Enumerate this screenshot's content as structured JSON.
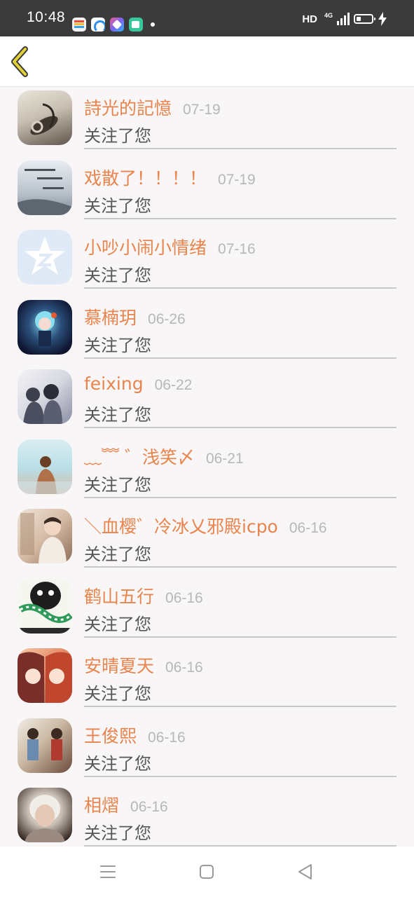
{
  "status_bar": {
    "time": "10:48",
    "hd": "HD",
    "network": "4G",
    "notification_icons": [
      "wallet-app-icon",
      "browser-app-icon",
      "gallery-app-icon",
      "messages-app-icon"
    ]
  },
  "header": {
    "back_icon": "chevron-left-icon",
    "accent_color": "#e2d13a"
  },
  "colors": {
    "name": "#e8844c",
    "date": "#b7b7b7",
    "action": "#565656",
    "background": "#f9f6f8"
  },
  "followers": [
    {
      "name": "詩光的記憶",
      "date": "07-19",
      "action": "关注了您"
    },
    {
      "name": "戏散了！！！！",
      "date": "07-19",
      "action": "关注了您"
    },
    {
      "name": "小吵小闹小情绪",
      "date": "07-16",
      "action": "关注了您"
    },
    {
      "name": "慕楠玥",
      "date": "06-26",
      "action": "关注了您"
    },
    {
      "name": "feixing",
      "date": "06-22",
      "action": "关注了您"
    },
    {
      "name": "﹏﹌ ゛浅笑〆",
      "date": "06-21",
      "action": "关注了您"
    },
    {
      "name": "＼血樱゛冷冰乂邪殿icpo",
      "date": "06-16",
      "action": "关注了您"
    },
    {
      "name": "鹤山五行",
      "date": "06-16",
      "action": "关注了您"
    },
    {
      "name": "安晴夏天",
      "date": "06-16",
      "action": "关注了您"
    },
    {
      "name": "王俊熙",
      "date": "06-16",
      "action": "关注了您"
    },
    {
      "name": "相熠",
      "date": "06-16",
      "action": "关注了您"
    }
  ],
  "nav": {
    "menu_icon": "menu-icon",
    "home_icon": "home-square-icon",
    "back_icon": "back-triangle-icon"
  }
}
